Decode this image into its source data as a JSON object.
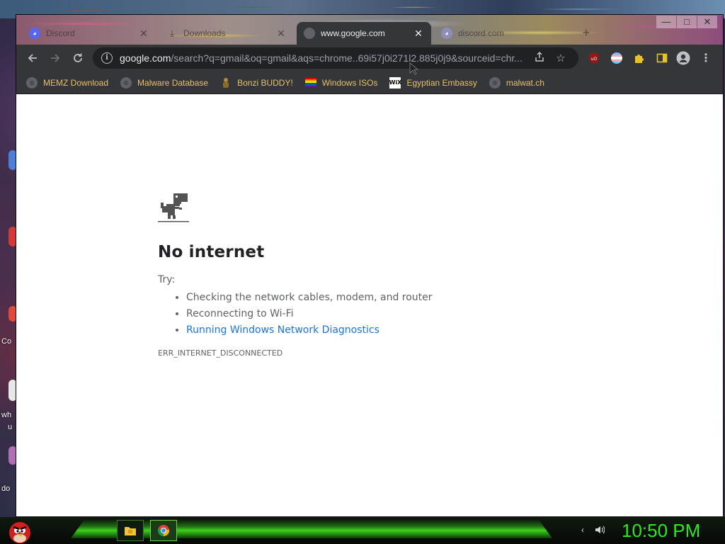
{
  "tabs": [
    {
      "title": "Discord",
      "icon": "discord-icon",
      "active": false
    },
    {
      "title": "Downloads",
      "icon": "download-icon",
      "active": false
    },
    {
      "title": "www.google.com",
      "icon": "globe-icon",
      "active": true
    },
    {
      "title": "discord.com",
      "icon": "discord-icon",
      "active": false
    }
  ],
  "window_controls": {
    "minimize": "—",
    "maximize": "□",
    "close": "✕"
  },
  "toolbar": {
    "url_host": "google.com",
    "url_rest": "/search?q=gmail&oq=gmail&aqs=chrome..69i57j0i271l2.885j0j9&sourceid=chr..."
  },
  "bookmarks": [
    {
      "label": "MEMZ Download",
      "icon": "globe-icon"
    },
    {
      "label": "Malware Database",
      "icon": "globe-icon"
    },
    {
      "label": "Bonzi BUDDY!",
      "icon": "bonzi-icon"
    },
    {
      "label": "Windows ISOs",
      "icon": "rainbow-flag-icon"
    },
    {
      "label": "Egyptian Embassy",
      "icon": "wix-icon"
    },
    {
      "label": "malwat.ch",
      "icon": "globe-icon"
    }
  ],
  "error_page": {
    "heading": "No internet",
    "try_label": "Try:",
    "suggestions": [
      "Checking the network cables, modem, and router",
      "Reconnecting to Wi-Fi"
    ],
    "diagnostics_link": "Running Windows Network Diagnostics",
    "error_code": "ERR_INTERNET_DISCONNECTED"
  },
  "taskbar": {
    "clock": "10:50 PM",
    "start_icon": "angry-bird-icon",
    "pinned": [
      "file-explorer-icon",
      "chrome-icon"
    ]
  },
  "colors": {
    "accent_green": "#2ee81f",
    "link_blue": "#1a73e8",
    "bookmark_text": "#e8c06a",
    "browser_chrome": "#35363a"
  },
  "desktop": {
    "label_c": "Co",
    "label_wh": "wh",
    "label_u": "u",
    "label_do": "do"
  }
}
